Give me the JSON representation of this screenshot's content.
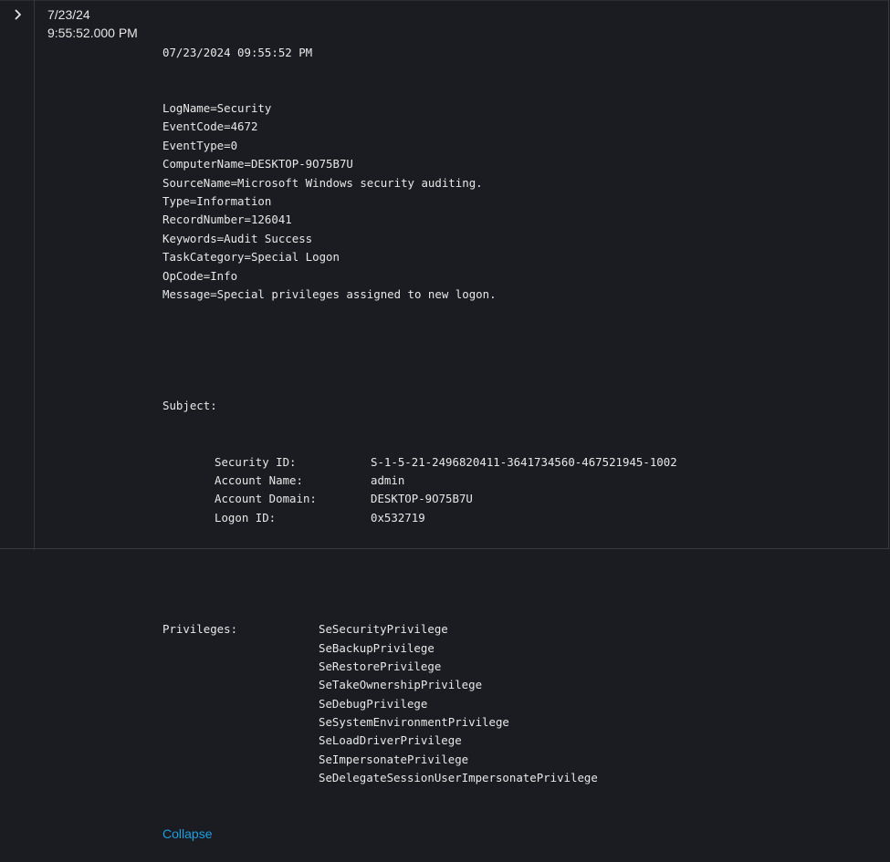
{
  "row": {
    "date": "7/23/24",
    "time": "9:55:52.000 PM"
  },
  "event": {
    "timestamp": "07/23/2024 09:55:52 PM",
    "fields": [
      "LogName=Security",
      "EventCode=4672",
      "EventType=0",
      "ComputerName=DESKTOP-9O75B7U",
      "SourceName=Microsoft Windows security auditing.",
      "Type=Information",
      "RecordNumber=126041",
      "Keywords=Audit Success",
      "TaskCategory=Special Logon",
      "OpCode=Info",
      "Message=Special privileges assigned to new logon."
    ],
    "subject_label": "Subject:",
    "subject": [
      {
        "key": "Security ID:",
        "value": "S-1-5-21-2496820411-3641734560-467521945-1002"
      },
      {
        "key": "Account Name:",
        "value": "admin"
      },
      {
        "key": "Account Domain:",
        "value": "DESKTOP-9O75B7U"
      },
      {
        "key": "Logon ID:",
        "value": "0x532719"
      }
    ],
    "privileges_label": "Privileges:",
    "privileges": [
      "SeSecurityPrivilege",
      "SeBackupPrivilege",
      "SeRestorePrivilege",
      "SeTakeOwnershipPrivilege",
      "SeDebugPrivilege",
      "SeSystemEnvironmentPrivilege",
      "SeLoadDriverPrivilege",
      "SeImpersonatePrivilege",
      "SeDelegateSessionUserImpersonatePrivilege"
    ]
  },
  "collapse_label": "Collapse",
  "icons": {
    "expand": "chevron-right-icon"
  },
  "colors": {
    "link": "#1a9fe0",
    "background": "#1b1c21"
  }
}
